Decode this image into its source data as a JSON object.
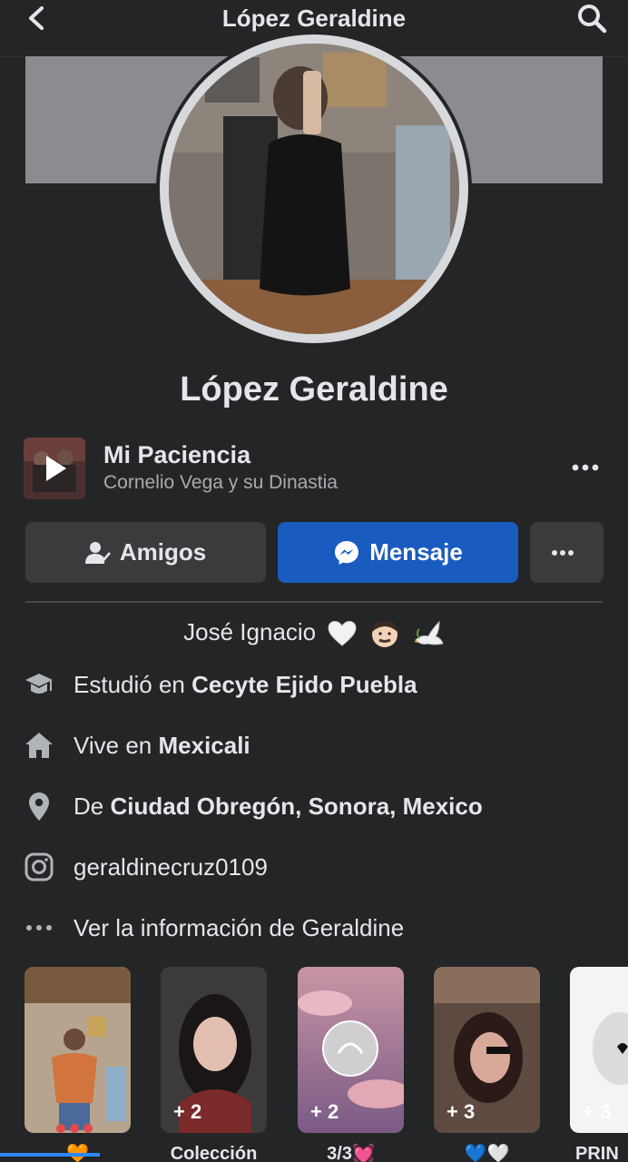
{
  "header": {
    "title": "López Geraldine"
  },
  "profile": {
    "name": "López Geraldine"
  },
  "song": {
    "title": "Mi Paciencia",
    "artist": "Cornelio Vega y su Dinastia"
  },
  "actions": {
    "friends_label": "Amigos",
    "message_label": "Mensaje"
  },
  "bio": {
    "text": "José Ignacio"
  },
  "info": {
    "studied_prefix": "Estudió en ",
    "studied_place": "Cecyte Ejido Puebla",
    "lives_prefix": "Vive en ",
    "lives_place": "Mexicali",
    "from_prefix": "De ",
    "from_place": "Ciudad Obregón",
    "from_rest": ", Sonora, Mexico",
    "instagram": "geraldinecruz0109",
    "see_more": "Ver la información de Geraldine"
  },
  "highlights": [
    {
      "count": "",
      "label": "🧡"
    },
    {
      "count": "+ 2",
      "label": "Colección"
    },
    {
      "count": "+ 2",
      "label": "3/3💓"
    },
    {
      "count": "+ 3",
      "label": "💙🤍"
    },
    {
      "count": "+ 3",
      "label": "PRIN"
    }
  ],
  "colors": {
    "accent": "#1a5bbf",
    "background": "#242526",
    "button_bg": "#3a3b3c"
  }
}
